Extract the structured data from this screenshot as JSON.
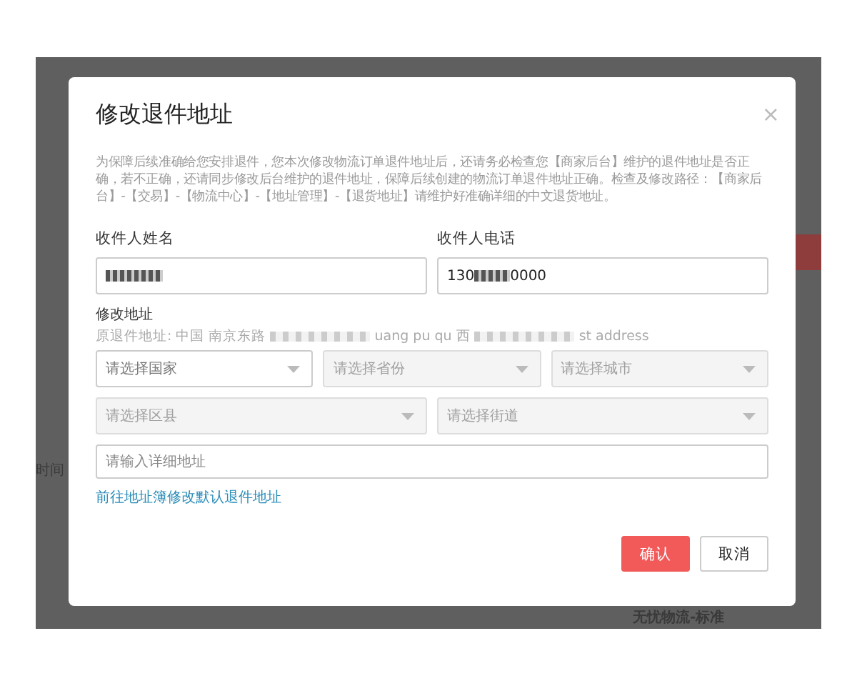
{
  "background": {
    "labels": [
      "时间",
      "无忧物流-标准"
    ]
  },
  "dialog": {
    "title": "修改退件地址",
    "close": "×",
    "notice": "为保障后续准确给您安排退件，您本次修改物流订单退件地址后，还请务必检查您【商家后台】维护的退件地址是否正确，若不正确，还请同步修改后台维护的退件地址，保障后续创建的物流订单退件地址正确。检查及修改路径：【商家后台】-【交易】-【物流中心】-【地址管理】-【退货地址】请维护好准确详细的中文退货地址。",
    "name_field": {
      "label": "收件人姓名"
    },
    "phone_field": {
      "label": "收件人电话",
      "value_before": "130",
      "value_after": "0000"
    },
    "address": {
      "label": "修改地址",
      "original_parts": [
        "原退件地址: 中国 南京东路",
        "uang pu qu 西",
        "st address"
      ],
      "selects_row1": [
        {
          "placeholder": "请选择国家",
          "disabled": false
        },
        {
          "placeholder": "请选择省份",
          "disabled": true
        },
        {
          "placeholder": "请选择城市",
          "disabled": true
        }
      ],
      "selects_row2": [
        {
          "placeholder": "请选择区县",
          "disabled": true
        },
        {
          "placeholder": "请选择街道",
          "disabled": true
        }
      ],
      "detail": {
        "placeholder": "请输入详细地址"
      },
      "link": "前往地址簿修改默认退件地址"
    },
    "buttons": [
      {
        "label": "确认",
        "kind": "primary"
      },
      {
        "label": "取消",
        "kind": "default"
      }
    ]
  }
}
